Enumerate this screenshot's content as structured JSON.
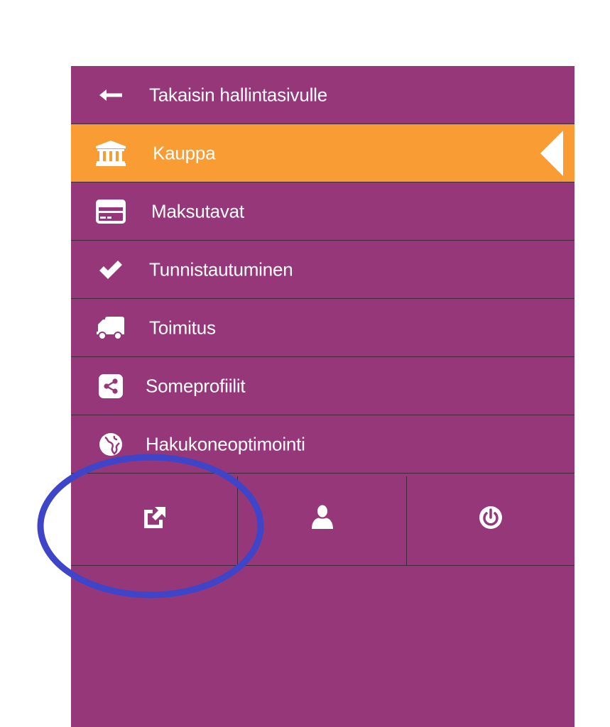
{
  "sidebar": {
    "items": [
      {
        "label": "Takaisin hallintasivulle",
        "icon": "arrow-left-icon"
      },
      {
        "label": "Kauppa",
        "icon": "bank-icon",
        "active": true
      },
      {
        "label": "Maksutavat",
        "icon": "credit-card-icon"
      },
      {
        "label": "Tunnistautuminen",
        "icon": "checkmark-icon"
      },
      {
        "label": "Toimitus",
        "icon": "truck-icon"
      },
      {
        "label": "Someprofiilit",
        "icon": "share-icon"
      },
      {
        "label": "Hakukoneoptimointi",
        "icon": "globe-icon"
      }
    ],
    "footer_buttons": [
      {
        "icon": "external-link-icon"
      },
      {
        "icon": "user-icon"
      },
      {
        "icon": "power-icon"
      }
    ]
  },
  "colors": {
    "sidebar_bg": "#963779",
    "active_bg": "#fa9c34",
    "divider": "#3f2a3a",
    "text": "#ffffff",
    "annotation_stroke": "#3f45c8"
  }
}
